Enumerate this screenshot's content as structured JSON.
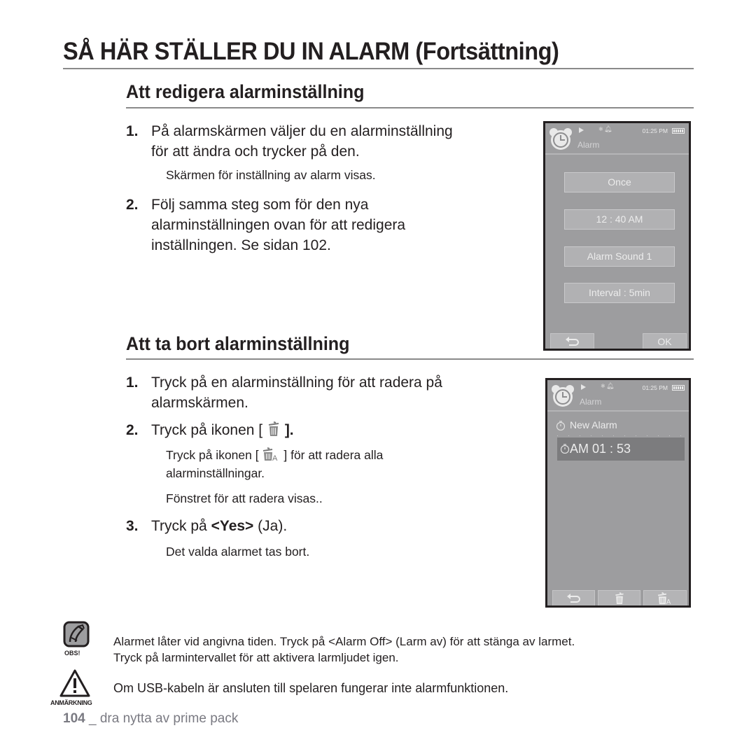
{
  "page": {
    "title": "SÅ HÄR STÄLLER DU IN ALARM (Fortsättning)",
    "footer": {
      "page_number": "104",
      "separator": "_",
      "section": "dra nytta av prime pack"
    }
  },
  "edit_section": {
    "heading": "Att redigera alarminställning",
    "steps": [
      {
        "num": "1.",
        "text_line1": "På alarmskärmen väljer du en alarminställning",
        "text_line2": "för att ändra och trycker på den.",
        "sub": "Skärmen för inställning av alarm visas."
      },
      {
        "num": "2.",
        "text_line1": "Följ samma steg som för den nya",
        "text_line2": "alarminställningen ovan för att redigera",
        "text_line3": "inställningen. Se sidan 102."
      }
    ]
  },
  "delete_section": {
    "heading": "Att ta bort alarminställning",
    "steps": [
      {
        "num": "1.",
        "text_line1": "Tryck på en alarminställning för att radera på",
        "text_line2": "alarmskärmen."
      },
      {
        "num": "2.",
        "text_before": "Tryck på ikonen [",
        "text_after": "].",
        "icon": "trash-icon",
        "sub1_before": "Tryck på ikonen [",
        "sub1_after": "] för att radera alla",
        "sub1_line2": "alarminställningar.",
        "sub1_icon": "trash-all-icon",
        "sub2": "Fönstret för att radera visas.."
      },
      {
        "num": "3.",
        "text_before": "Tryck på",
        "text_bold": "<Yes>",
        "text_after": "(Ja).",
        "sub": "Det valda alarmet tas bort."
      }
    ]
  },
  "device_edit": {
    "status_time": "01:25 PM",
    "title": "Alarm",
    "settings": [
      "Once",
      "12 : 40 AM",
      "Alarm Sound 1",
      "Interval : 5min"
    ],
    "back_icon": "back-arrow-icon",
    "ok_label": "OK"
  },
  "device_list": {
    "status_time": "01:25 PM",
    "title": "Alarm",
    "new_alarm_label": "New Alarm",
    "selected_alarm": "AM 01 : 53",
    "buttons": [
      "back-arrow-icon",
      "trash-icon",
      "trash-all-icon"
    ]
  },
  "notes": {
    "obs": {
      "label": "OBS!",
      "line1": "Alarmet låter vid angivna tiden. Tryck på <Alarm Off> (Larm av) för att stänga av larmet.",
      "line2": "Tryck på larmintervallet för att aktivera larmljudet igen."
    },
    "caution": {
      "label": "ANMÄRKNING",
      "text": "Om USB-kabeln är ansluten till spelaren fungerar inte alarmfunktionen."
    }
  }
}
